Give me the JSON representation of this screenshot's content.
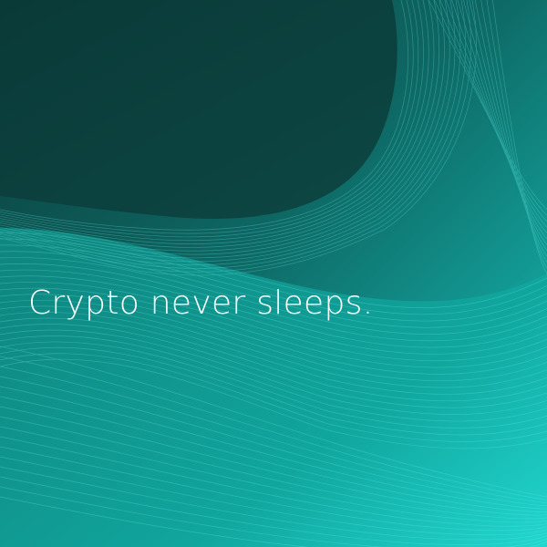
{
  "headline": "Crypto never sleeps.",
  "colors": {
    "background_dark": "#0a3f3c",
    "background_mid": "#0d7f78",
    "background_light": "#1ed8cf",
    "wave_lines": "#5fe7df",
    "text": "#ffffff"
  }
}
